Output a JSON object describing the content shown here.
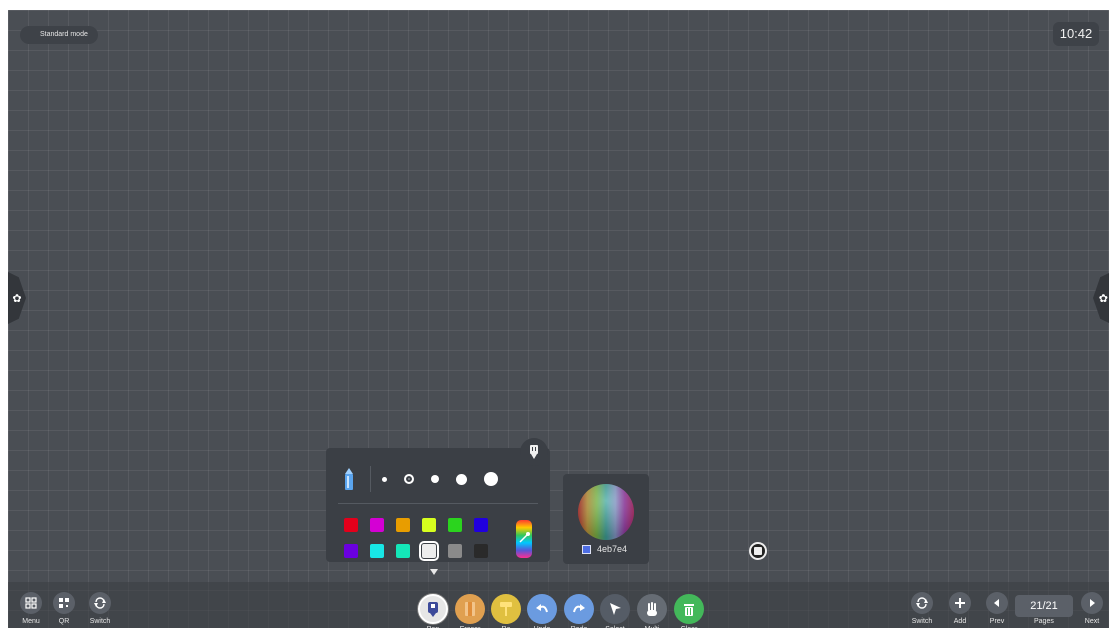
{
  "header": {
    "mode_label": "Standard mode",
    "clock": "10:42"
  },
  "side_tabs": {
    "left_icon": "settings-icon",
    "right_icon": "settings-icon"
  },
  "pen_panel": {
    "pen_type_icon": "pencil-icon",
    "pin_icon": "pin-icon",
    "sizes": [
      1,
      2,
      3,
      4,
      5
    ],
    "selected_size": 2,
    "colors": [
      "#e3001b",
      "#d400d4",
      "#e89d00",
      "#d7ff1e",
      "#2bd41e",
      "#2000e0",
      "#6a00e0",
      "#18e6e6",
      "#14e6b8",
      "#ededed",
      "#8a8a8a",
      "#2a2a2a"
    ],
    "selected_color_index": 9,
    "custom_color_icon": "rainbow-picker-icon"
  },
  "color_picker": {
    "hex": "4eb7e4",
    "swatch_color": "#4e6ee4"
  },
  "toolbar_left": [
    {
      "label": "Menu",
      "icon": "grid-icon"
    },
    {
      "label": "QR",
      "icon": "qr-icon"
    },
    {
      "label": "Switch",
      "icon": "switch-icon"
    }
  ],
  "tools": [
    {
      "label": "Pen",
      "icon": "pen-icon",
      "color": "#e6e6e6",
      "active": true
    },
    {
      "label": "Eraser",
      "icon": "eraser-icon",
      "color": "#e0a050"
    },
    {
      "label": "Ro",
      "icon": "roller-icon",
      "color": "#e0c040"
    },
    {
      "label": "Undo",
      "icon": "undo-icon",
      "color": "#6b9be0"
    },
    {
      "label": "Redo",
      "icon": "redo-icon",
      "color": "#6b9be0"
    },
    {
      "label": "Select",
      "icon": "cursor-icon",
      "color": "#555c66"
    },
    {
      "label": "Multi",
      "icon": "multitouch-icon",
      "color": "#666c74"
    },
    {
      "label": "Clear",
      "icon": "trash-icon",
      "color": "#43b85a"
    }
  ],
  "toolbar_right": [
    {
      "label": "Switch",
      "icon": "switch-icon"
    },
    {
      "label": "Add",
      "icon": "plus-icon"
    },
    {
      "label": "Prev",
      "icon": "prev-icon"
    },
    {
      "label": "Pages"
    },
    {
      "label": "Next",
      "icon": "next-icon"
    }
  ],
  "page_indicator": "21/21"
}
